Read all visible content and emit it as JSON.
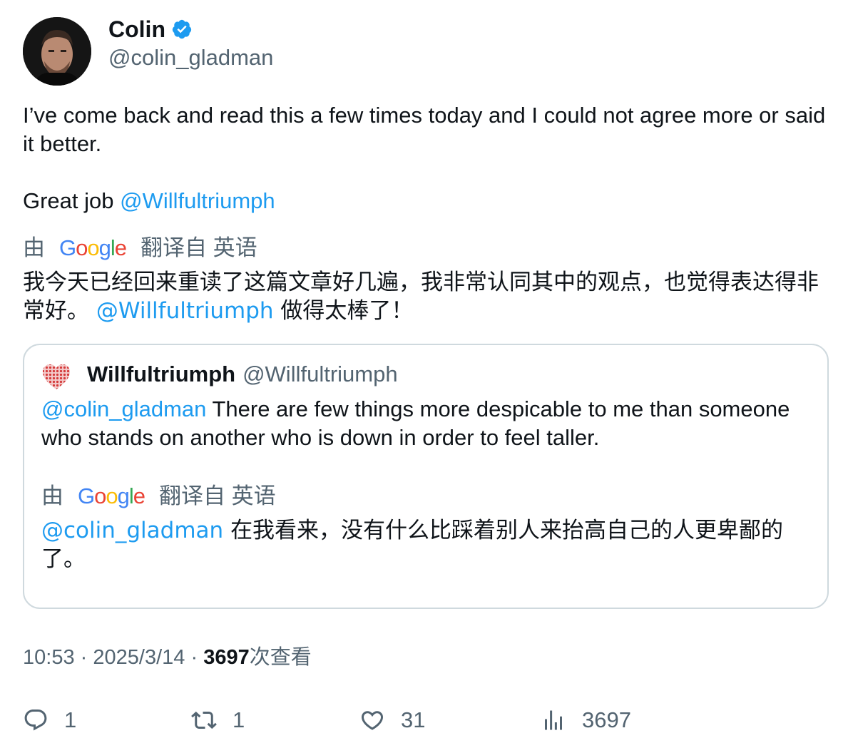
{
  "author": {
    "name": "Colin",
    "handle": "@colin_gladman",
    "verified": true
  },
  "tweet": {
    "text_line1": "I’ve come back and read this a few times today and I could not agree more or said it better.",
    "text_line2_prefix": "Great job ",
    "text_line2_mention": "@Willfultriumph"
  },
  "translation": {
    "by_label": "由",
    "provider": "Google",
    "from_label": "翻译自 英语",
    "text_part1": "我今天已经回来重读了这篇文章好几遍，我非常认同其中的观点，也觉得表达得非常好。",
    "mention": "@Willfultriumph",
    "text_part2": "做得太棒了！"
  },
  "quoted_tweet": {
    "name": "Willfultriumph",
    "handle": "@Willfultriumph",
    "mention": "@colin_gladman",
    "text": "There are few things more despicable to me than someone who stands on another who is down in order to feel taller.",
    "translation": {
      "by_label": "由",
      "provider": "Google",
      "from_label": "翻译自 英语",
      "mention": "@colin_gladman",
      "text": "在我看来，没有什么比踩着别人来抬高自己的人更卑鄙的了。"
    }
  },
  "meta": {
    "time": "10:53",
    "separator": "·",
    "date": "2025/3/14",
    "views_count": "3697",
    "views_label": "次查看"
  },
  "actions": {
    "replies": "1",
    "retweets": "1",
    "likes": "31",
    "views": "3697"
  },
  "icons": [
    "verified-badge-icon",
    "reply-icon",
    "retweet-icon",
    "like-icon",
    "views-icon",
    "google-logo",
    "heart-avatar-icon"
  ],
  "colors": {
    "link": "#1d9bf0",
    "secondary_text": "#536471",
    "primary_text": "#0f1419",
    "border": "#cfd9de"
  }
}
